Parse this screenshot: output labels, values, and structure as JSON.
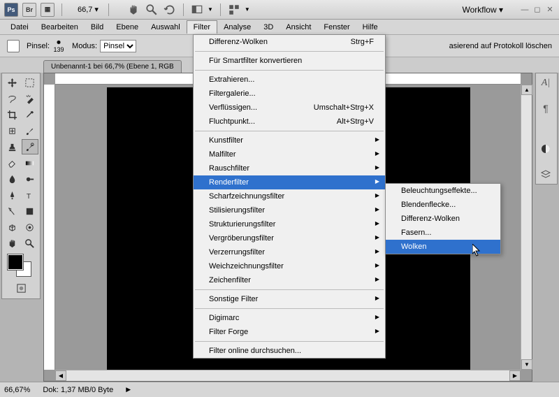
{
  "app": {
    "zoom": "66,7",
    "arrow": "▾",
    "workflow": "Workflow ▾"
  },
  "menu": {
    "items": [
      "Datei",
      "Bearbeiten",
      "Bild",
      "Ebene",
      "Auswahl",
      "Filter",
      "Analyse",
      "3D",
      "Ansicht",
      "Fenster",
      "Hilfe"
    ],
    "active": "Filter"
  },
  "options": {
    "pinsel": "Pinsel:",
    "pinsel_size": "139",
    "modus": "Modus:",
    "modus_val": "Pinsel",
    "right": "asierend auf Protokoll löschen"
  },
  "doc": {
    "tab": "Unbenannt-1 bei 66,7% (Ebene 1, RGB"
  },
  "status": {
    "zoom": "66,67%",
    "dok": "Dok: 1,37 MB/0 Byte"
  },
  "filter_menu": {
    "top": [
      {
        "l": "Differenz-Wolken",
        "k": "Strg+F"
      }
    ],
    "conv": {
      "l": "Für Smartfilter konvertieren"
    },
    "g1": [
      {
        "l": "Extrahieren...",
        "k": ""
      },
      {
        "l": "Filtergalerie...",
        "k": ""
      },
      {
        "l": "Verflüssigen...",
        "k": "Umschalt+Strg+X"
      },
      {
        "l": "Fluchtpunkt...",
        "k": "Alt+Strg+V"
      }
    ],
    "g2": [
      "Kunstfilter",
      "Malfilter",
      "Rauschfilter",
      "Renderfilter",
      "Scharfzeichnungsfilter",
      "Stilisierungsfilter",
      "Strukturierungsfilter",
      "Vergröberungsfilter",
      "Verzerrungsfilter",
      "Weichzeichnungsfilter",
      "Zeichenfilter"
    ],
    "g3": [
      "Sonstige Filter"
    ],
    "g4": [
      "Digimarc",
      "Filter Forge"
    ],
    "g5": {
      "l": "Filter online durchsuchen..."
    },
    "highlighted": "Renderfilter"
  },
  "submenu": {
    "items": [
      "Beleuchtungseffekte...",
      "Blendenflecke...",
      "Differenz-Wolken",
      "Fasern...",
      "Wolken"
    ],
    "highlighted": "Wolken"
  }
}
